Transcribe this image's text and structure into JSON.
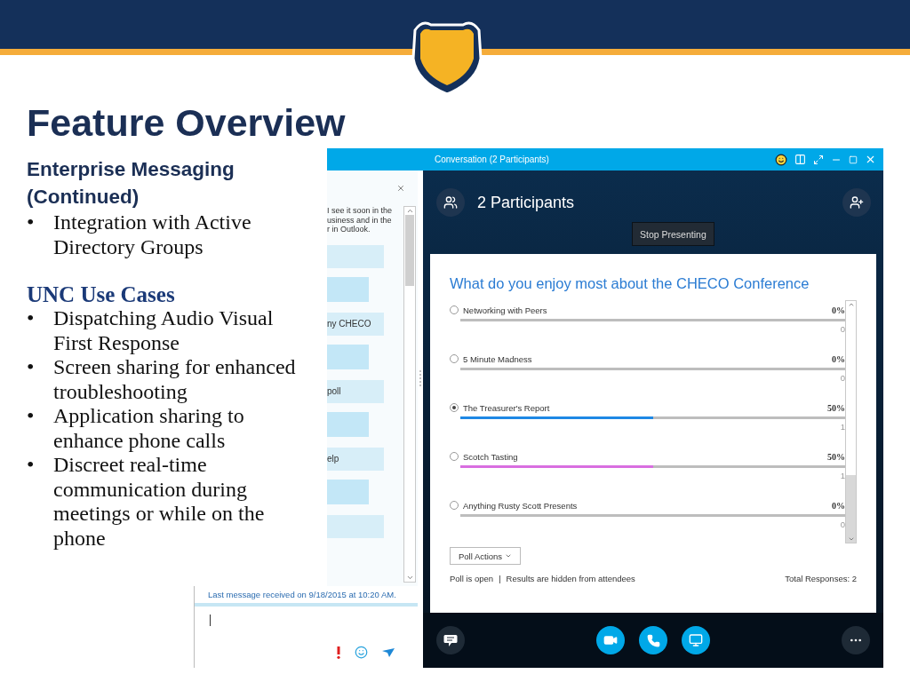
{
  "slide": {
    "title": "Feature Overview"
  },
  "left": {
    "heading": "Enterprise Messaging\n(Continued)",
    "bullets_a": [
      {
        "bullet": "•",
        "text": "Integration with Active Directory Groups"
      }
    ],
    "section": "UNC Use Cases",
    "bullets_b": [
      {
        "bullet": "•",
        "text": "Dispatching Audio Visual First Response"
      },
      {
        "bullet": "•",
        "text": "Screen sharing for enhanced troubleshooting"
      },
      {
        "bullet": "•",
        "text": "Application sharing to enhance phone calls"
      },
      {
        "bullet": "•",
        "text": "Discreet real-time communication during meetings or while on the phone"
      }
    ]
  },
  "chat": {
    "message_lines": [
      "I see it soon in the",
      "usiness and in the",
      "r in Outlook."
    ],
    "bubbles": [
      {
        "kind": "received"
      },
      {
        "kind": "sent"
      },
      {
        "kind": "received",
        "text": "ny CHECO"
      },
      {
        "kind": "sent"
      },
      {
        "kind": "received",
        "text": "poll"
      },
      {
        "kind": "sent"
      },
      {
        "kind": "received",
        "text": "elp"
      },
      {
        "kind": "sent"
      },
      {
        "kind": "received"
      }
    ],
    "last_message": "Last message received on 9/18/2015 at 10:20 AM."
  },
  "window": {
    "title": "Conversation (2 Participants)"
  },
  "conversation": {
    "participants": "2 Participants",
    "stop_presenting": "Stop Presenting"
  },
  "poll": {
    "question": "What do you enjoy most about the CHECO Conference",
    "options": [
      {
        "label": "Networking with Peers",
        "selected": false,
        "percent": "0%",
        "count": "0",
        "level": 0
      },
      {
        "label": "5 Minute Madness",
        "selected": false,
        "percent": "0%",
        "count": "0",
        "level": 0
      },
      {
        "label": "The Treasurer's Report",
        "selected": true,
        "percent": "50%",
        "count": "1",
        "level": 0.5,
        "color": "#1e88e5"
      },
      {
        "label": "Scotch Tasting",
        "selected": false,
        "percent": "50%",
        "count": "1",
        "level": 0.5,
        "color": "#d96ee0"
      },
      {
        "label": "Anything Rusty Scott Presents",
        "selected": false,
        "percent": "0%",
        "count": "0",
        "level": 0
      }
    ],
    "actions": "Poll Actions",
    "status": "Poll is open",
    "separator": "|",
    "visibility": "Results are hidden from attendees",
    "total": "Total Responses: 2"
  }
}
